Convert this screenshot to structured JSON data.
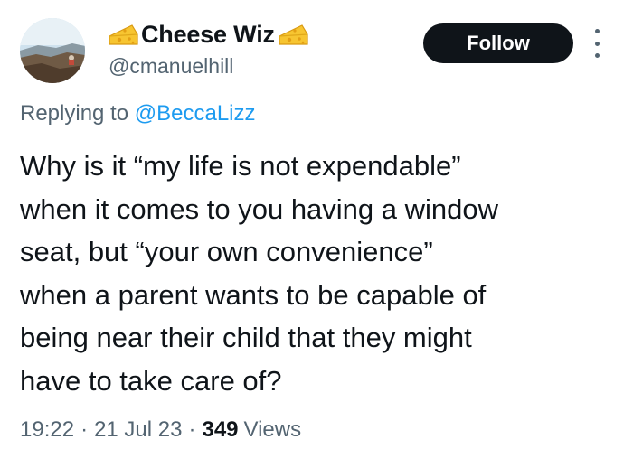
{
  "author": {
    "display_name": "Cheese Wiz",
    "handle": "@cmanuelhill",
    "avatar_icon": "landscape-avatar",
    "name_emoji": "cheese-icon"
  },
  "actions": {
    "follow_label": "Follow",
    "more_icon": "more-options-icon"
  },
  "reply": {
    "prefix": "Replying to ",
    "mention": "@BeccaLizz"
  },
  "tweet": {
    "text": "Why is it “my life is not expendable”\nwhen it comes to you having a window\nseat, but “your own convenience”\nwhen a parent wants to be capable of\nbeing near their child that they might\nhave to take care of?"
  },
  "meta": {
    "time": "19:22",
    "separator": "·",
    "date": "21 Jul 23",
    "views_count": "349",
    "views_label": "Views"
  },
  "colors": {
    "text": "#0f1419",
    "secondary": "#536471",
    "link": "#1d9bf0",
    "button_bg": "#0f1419"
  }
}
